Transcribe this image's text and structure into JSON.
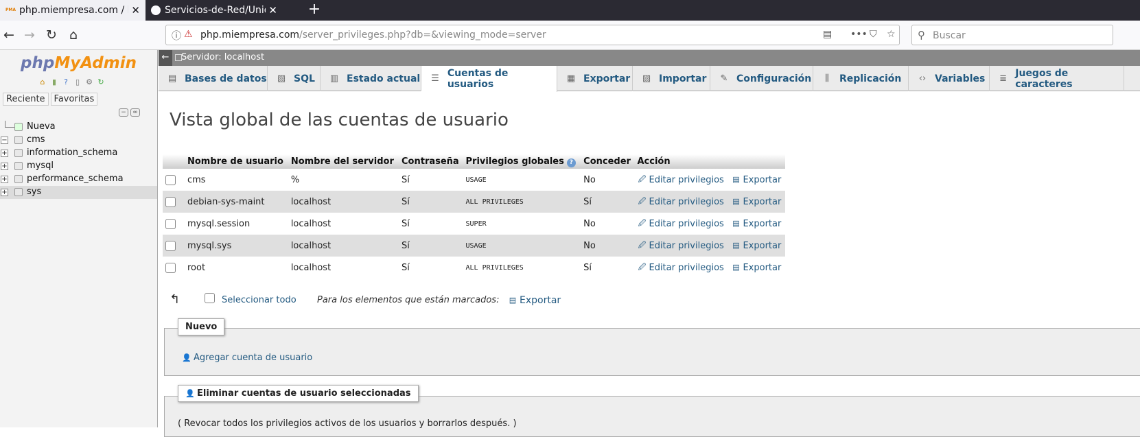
{
  "browser": {
    "tabs": [
      {
        "title": "php.miempresa.com / lo",
        "active": true,
        "icon": "phpmyadmin-favicon"
      },
      {
        "title": "Servicios-de-Red/Unidad",
        "active": false,
        "icon": "github-icon"
      }
    ],
    "url_domain": "php.miempresa.com",
    "url_path": "/server_privileges.php?db=&viewing_mode=server",
    "search_placeholder": "Buscar"
  },
  "sidebar": {
    "logo_php": "php",
    "logo_my": "MyAdmin",
    "tabs": [
      "Reciente",
      "Favoritas"
    ],
    "tree": [
      {
        "label": "Nueva",
        "expander": "",
        "selected": false
      },
      {
        "label": "cms",
        "expander": "−",
        "selected": false
      },
      {
        "label": "information_schema",
        "expander": "+",
        "selected": false
      },
      {
        "label": "mysql",
        "expander": "+",
        "selected": false
      },
      {
        "label": "performance_schema",
        "expander": "+",
        "selected": false
      },
      {
        "label": "sys",
        "expander": "+",
        "selected": true
      }
    ]
  },
  "server_bar": {
    "label": "Servidor: localhost"
  },
  "main_tabs": [
    {
      "label": "Bases de datos",
      "icon": "database-icon"
    },
    {
      "label": "SQL",
      "icon": "sql-icon"
    },
    {
      "label": "Estado actual",
      "icon": "status-icon"
    },
    {
      "label": "Cuentas de usuarios",
      "icon": "users-icon",
      "active": true
    },
    {
      "label": "Exportar",
      "icon": "export-icon"
    },
    {
      "label": "Importar",
      "icon": "import-icon"
    },
    {
      "label": "Configuración",
      "icon": "wrench-icon"
    },
    {
      "label": "Replicación",
      "icon": "replication-icon"
    },
    {
      "label": "Variables",
      "icon": "variables-icon"
    },
    {
      "label": "Juegos de caracteres",
      "icon": "charset-icon"
    }
  ],
  "page_title": "Vista global de las cuentas de usuario",
  "table": {
    "headers": [
      "Nombre de usuario",
      "Nombre del servidor",
      "Contraseña",
      "Privilegios globales",
      "Conceder",
      "Acción"
    ],
    "edit_label": "Editar privilegios",
    "export_label": "Exportar",
    "rows": [
      {
        "user": "cms",
        "host": "%",
        "password": "Sí",
        "privileges": "USAGE",
        "grant": "No"
      },
      {
        "user": "debian-sys-maint",
        "host": "localhost",
        "password": "Sí",
        "privileges": "ALL PRIVILEGES",
        "grant": "Sí"
      },
      {
        "user": "mysql.session",
        "host": "localhost",
        "password": "Sí",
        "privileges": "SUPER",
        "grant": "No"
      },
      {
        "user": "mysql.sys",
        "host": "localhost",
        "password": "Sí",
        "privileges": "USAGE",
        "grant": "No"
      },
      {
        "user": "root",
        "host": "localhost",
        "password": "Sí",
        "privileges": "ALL PRIVILEGES",
        "grant": "Sí"
      }
    ]
  },
  "bulk": {
    "select_all": "Seleccionar todo",
    "with_marked": "Para los elementos que están marcados:",
    "export": "Exportar"
  },
  "new_section": {
    "legend": "Nuevo",
    "add_user": "Agregar cuenta de usuario"
  },
  "delete_section": {
    "legend": "Eliminar cuentas de usuario seleccionadas",
    "revoke_text": "( Revocar todos los privilegios activos de los usuarios y borrarlos después. )"
  }
}
